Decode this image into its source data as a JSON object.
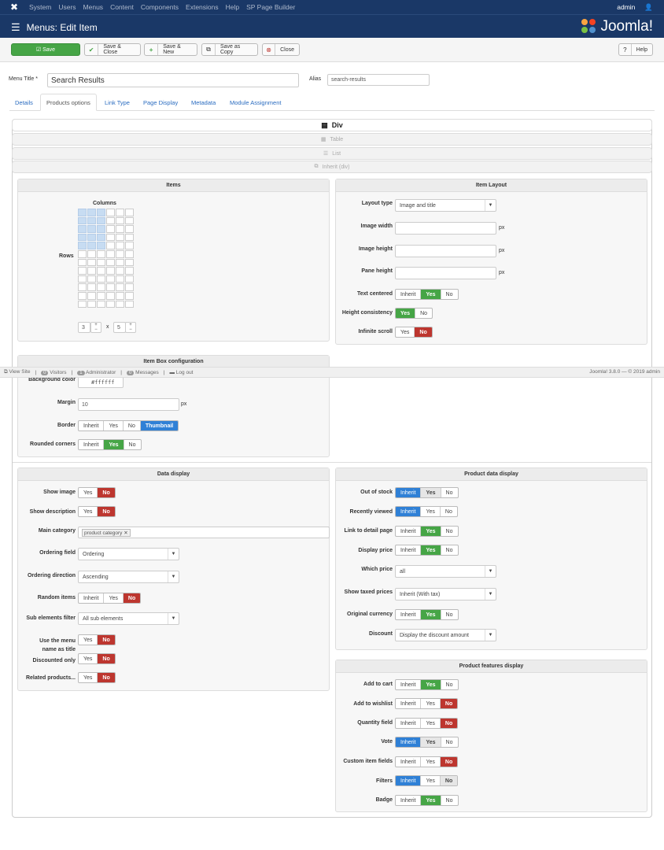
{
  "topnav": {
    "menu": [
      "System",
      "Users",
      "Menus",
      "Content",
      "Components",
      "Extensions",
      "Help",
      "SP Page Builder"
    ],
    "user": "admin",
    "user_icon": "👤"
  },
  "titlebar": {
    "title": "Menus: Edit Item",
    "brand": "Joomla!"
  },
  "toolbar": {
    "save": "Save",
    "save_close": "Save & Close",
    "save_new": "Save & New",
    "save_copy": "Save as Copy",
    "close": "Close",
    "help": "Help"
  },
  "form": {
    "menu_title_label": "Menu Title *",
    "menu_title_value": "Search Results",
    "alias_label": "Alias",
    "alias_value": "search-results"
  },
  "tabs": [
    "Details",
    "Products options",
    "Link Type",
    "Page Display",
    "Metadata",
    "Module Assignment"
  ],
  "layout_selector": [
    "Div",
    "Table",
    "List",
    "Inherit (div)"
  ],
  "items_panel": {
    "title": "Items",
    "columns_label": "Columns",
    "rows_label": "Rows",
    "cols_value": "3",
    "x": "x",
    "rows_value": "5",
    "plus": "+",
    "minus": "−"
  },
  "item_layout": {
    "title": "Item Layout",
    "layout_type_label": "Layout type",
    "layout_type_value": "Image and title",
    "image_width_label": "Image width",
    "image_height_label": "Image height",
    "pane_height_label": "Pane height",
    "px": "px",
    "text_centered_label": "Text centered",
    "height_consistency_label": "Height consistency",
    "infinite_scroll_label": "Infinite scroll"
  },
  "item_box": {
    "title": "Item Box configuration",
    "bg_label": "Background color",
    "bg_value": "#ffffff",
    "margin_label": "Margin",
    "margin_value": "10",
    "px": "px",
    "border_label": "Border",
    "rounded_label": "Rounded corners"
  },
  "statusbar": {
    "view_site": "View Site",
    "visitors_count": "0",
    "visitors": "Visitors",
    "admin_count": "1",
    "admin": "Administrator",
    "messages_count": "0",
    "messages": "Messages",
    "logout": "Log out",
    "version": "Joomla! 3.8.0  —  © 2019 admin"
  },
  "data_display": {
    "title": "Data display",
    "show_image": "Show image",
    "show_description": "Show description",
    "main_category": "Main category",
    "main_category_tag": "product category",
    "ordering_field": "Ordering field",
    "ordering_field_value": "Ordering",
    "ordering_direction": "Ordering direction",
    "ordering_direction_value": "Ascending",
    "random_items": "Random items",
    "sub_filter": "Sub elements filter",
    "sub_filter_value": "All sub elements",
    "use_menu_name": "Use the menu",
    "use_menu_name2": "name as title",
    "discounted_only": "Discounted only",
    "related_products": "Related products..."
  },
  "product_data_display": {
    "title": "Product data display",
    "out_of_stock": "Out of stock",
    "recently_viewed": "Recently viewed",
    "link_to_detail": "Link to detail page",
    "display_price": "Display price",
    "which_price": "Which price",
    "which_price_value": "all",
    "show_taxed": "Show taxed prices",
    "show_taxed_value": "Inherit (With tax)",
    "original_currency": "Original currency",
    "discount": "Discount",
    "discount_value": "Display the discount amount"
  },
  "product_features": {
    "title": "Product features display",
    "add_to_cart": "Add to cart",
    "add_to_wishlist": "Add to wishlist",
    "quantity_field": "Quantity field",
    "vote": "Vote",
    "custom_item_fields": "Custom item fields",
    "filters": "Filters",
    "badge": "Badge"
  },
  "opt": {
    "inherit": "Inherit",
    "yes": "Yes",
    "no": "No",
    "thumbnail": "Thumbnail"
  },
  "colors": {
    "navy": "#1a3867",
    "green": "#46a546",
    "red": "#bd362f",
    "blue": "#2f80d6"
  }
}
